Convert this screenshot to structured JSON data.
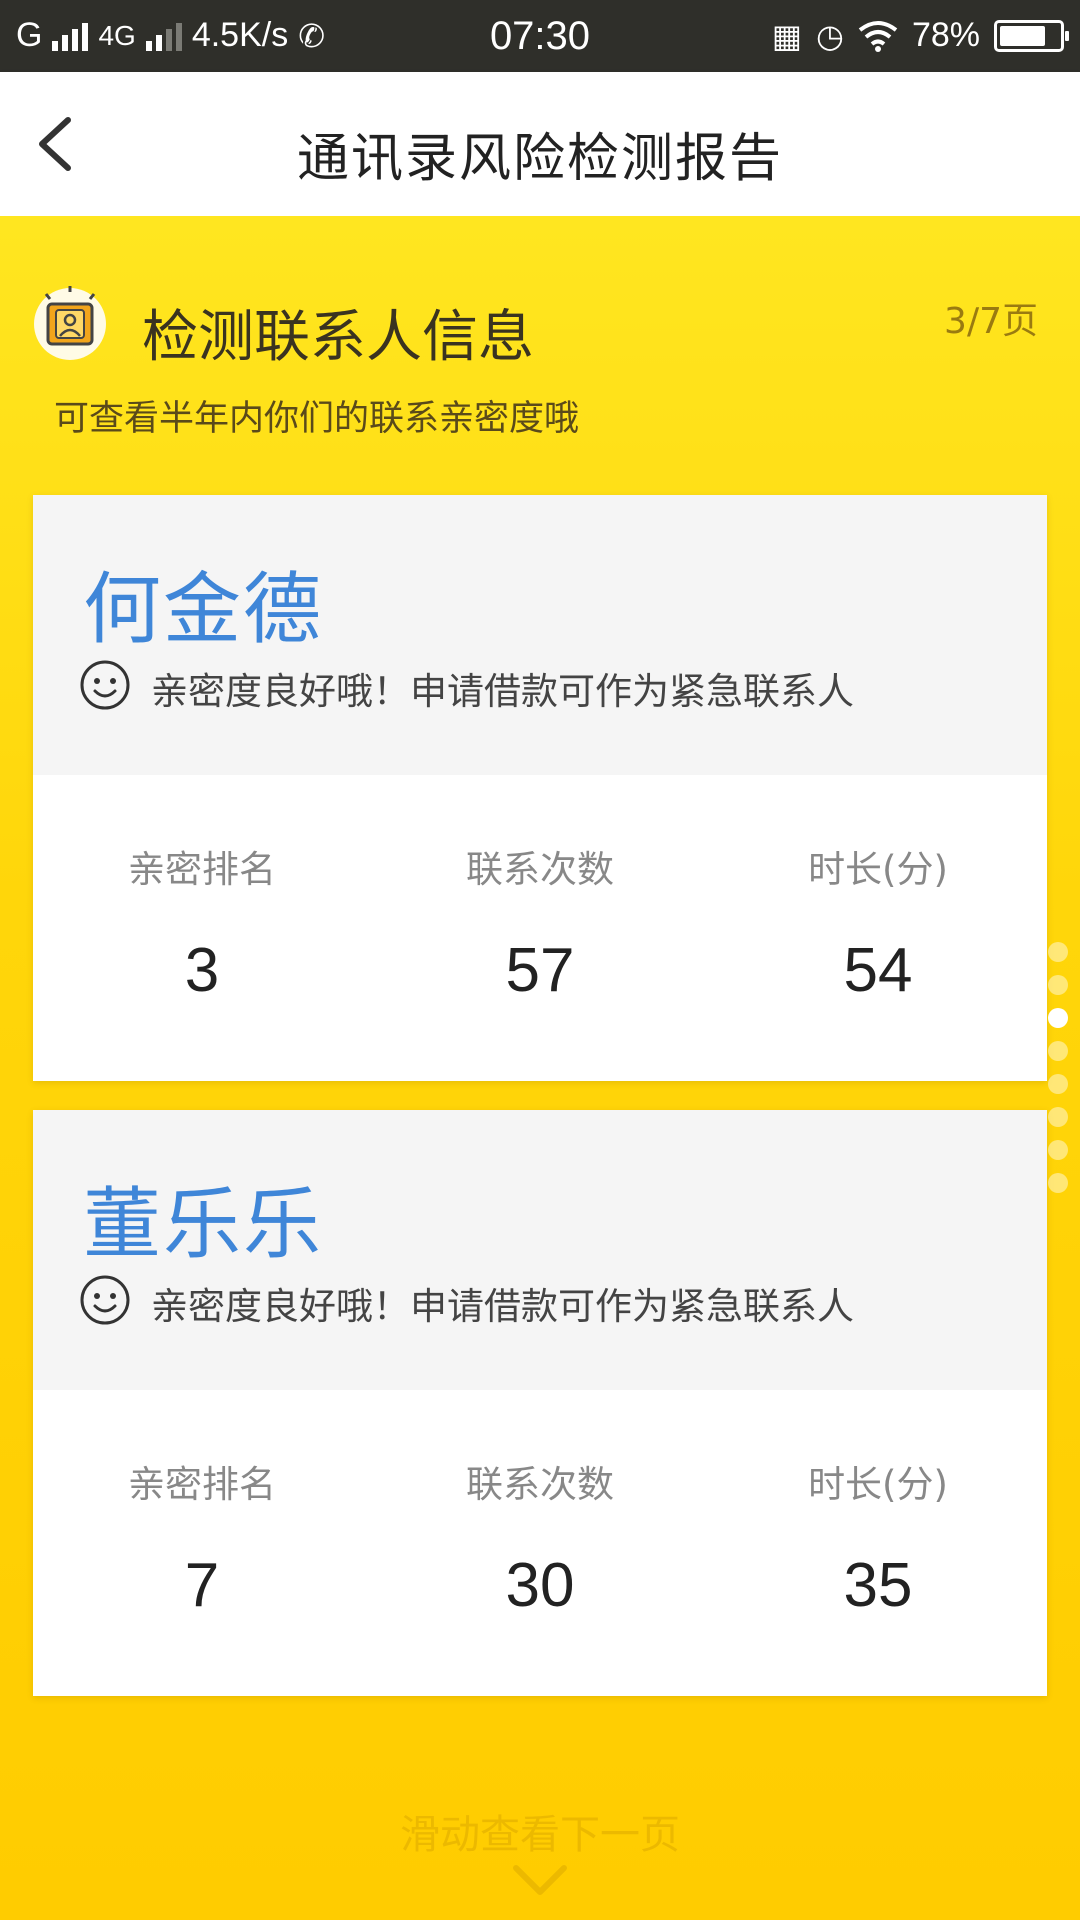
{
  "status_bar": {
    "carrier1": "G",
    "network": "4G",
    "speed": "4.5K/s",
    "time": "07:30",
    "battery": "78%",
    "battery_level": 0.78
  },
  "header": {
    "title": "通讯录风险检测报告"
  },
  "section": {
    "title": "检测联系人信息",
    "page": "3/7页",
    "subtitle": "可查看半年内你们的联系亲密度哦"
  },
  "contacts": [
    {
      "name": "何金德",
      "note": "亲密度良好哦！申请借款可作为紧急联系人",
      "stats": [
        {
          "label": "亲密排名",
          "value": "3"
        },
        {
          "label": "联系次数",
          "value": "57"
        },
        {
          "label": "时长(分)",
          "value": "54"
        }
      ]
    },
    {
      "name": "董乐乐",
      "note": "亲密度良好哦！申请借款可作为紧急联系人",
      "stats": [
        {
          "label": "亲密排名",
          "value": "7"
        },
        {
          "label": "联系次数",
          "value": "30"
        },
        {
          "label": "时长(分)",
          "value": "35"
        }
      ]
    }
  ],
  "pager": {
    "total": 8,
    "active_index": 2
  },
  "footer": {
    "hint": "滑动查看下一页"
  },
  "colors": {
    "accent_yellow": "#ffd60a",
    "name_blue": "#3f86d8",
    "status_bar": "#2f2f2a"
  }
}
